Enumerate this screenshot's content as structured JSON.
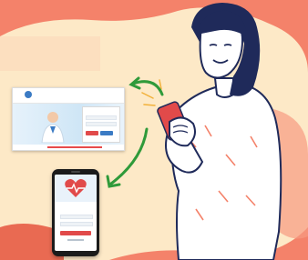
{
  "illustration": {
    "colors": {
      "background": "#f4826a",
      "blob": "#fde9c7",
      "arrow": "#2f9a3a",
      "accent_red": "#e14a4a",
      "brand_blue": "#1f5fa8",
      "hair": "#1f2a5a",
      "skin": "#ffffff"
    },
    "icons": [
      "laptop-icon",
      "smartphone-icon",
      "woman-illustration",
      "heart-icon",
      "arrow-icon"
    ]
  }
}
